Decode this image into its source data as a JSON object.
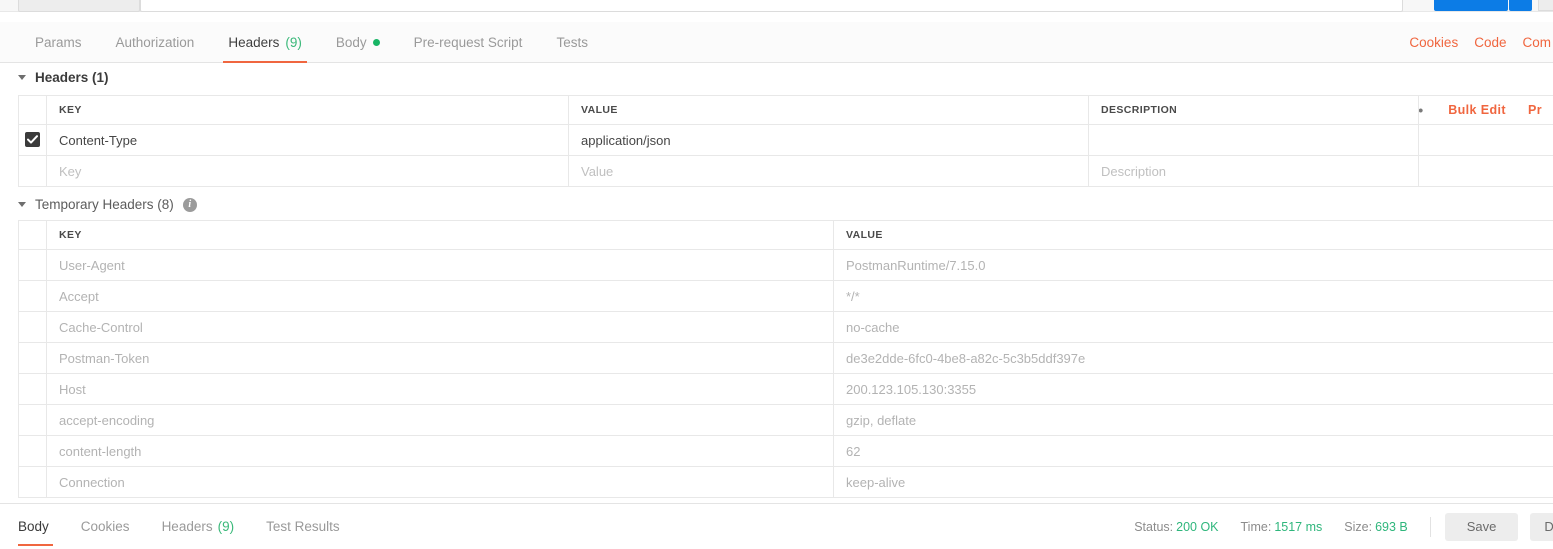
{
  "request_tabs": [
    {
      "label": "Params",
      "count": "",
      "active": false,
      "dot": false
    },
    {
      "label": "Authorization",
      "count": "",
      "active": false,
      "dot": false
    },
    {
      "label": "Headers",
      "count": "(9)",
      "active": true,
      "dot": false
    },
    {
      "label": "Body",
      "count": "",
      "active": false,
      "dot": true
    },
    {
      "label": "Pre-request Script",
      "count": "",
      "active": false,
      "dot": false
    },
    {
      "label": "Tests",
      "count": "",
      "active": false,
      "dot": false
    }
  ],
  "request_actions": [
    {
      "label": "Cookies"
    },
    {
      "label": "Code"
    },
    {
      "label": "Com"
    }
  ],
  "headers_section": {
    "title": "Headers (1)",
    "columns": [
      "KEY",
      "VALUE",
      "DESCRIPTION"
    ],
    "tools": {
      "dots": "•••",
      "bulk_edit": "Bulk Edit",
      "presets": "Pr"
    },
    "rows": [
      {
        "checked": true,
        "key": "Content-Type",
        "value": "application/json",
        "description": ""
      }
    ],
    "placeholder_row": {
      "key": "Key",
      "value": "Value",
      "description": "Description"
    }
  },
  "temporary_headers_section": {
    "title": "Temporary Headers (8)",
    "info_glyph": "i",
    "columns": [
      "KEY",
      "VALUE"
    ],
    "rows": [
      {
        "key": "User-Agent",
        "value": "PostmanRuntime/7.15.0"
      },
      {
        "key": "Accept",
        "value": "*/*"
      },
      {
        "key": "Cache-Control",
        "value": "no-cache"
      },
      {
        "key": "Postman-Token",
        "value": "de3e2dde-6fc0-4be8-a82c-5c3b5ddf397e"
      },
      {
        "key": "Host",
        "value": "200.123.105.130:3355"
      },
      {
        "key": "accept-encoding",
        "value": "gzip, deflate"
      },
      {
        "key": "content-length",
        "value": "62"
      },
      {
        "key": "Connection",
        "value": "keep-alive"
      }
    ]
  },
  "response": {
    "tabs": [
      {
        "label": "Body",
        "count": "",
        "active": true
      },
      {
        "label": "Cookies",
        "count": "",
        "active": false
      },
      {
        "label": "Headers",
        "count": "(9)",
        "active": false
      },
      {
        "label": "Test Results",
        "count": "",
        "active": false
      }
    ],
    "status_label": "Status:",
    "status_value": "200 OK",
    "time_label": "Time:",
    "time_value": "1517 ms",
    "size_label": "Size:",
    "size_value": "693 B",
    "save_label": "Save",
    "download_label": "Do"
  },
  "colors": {
    "accent": "#f0663f",
    "green": "#2fb67c",
    "send_blue": "#0c7ce6"
  }
}
